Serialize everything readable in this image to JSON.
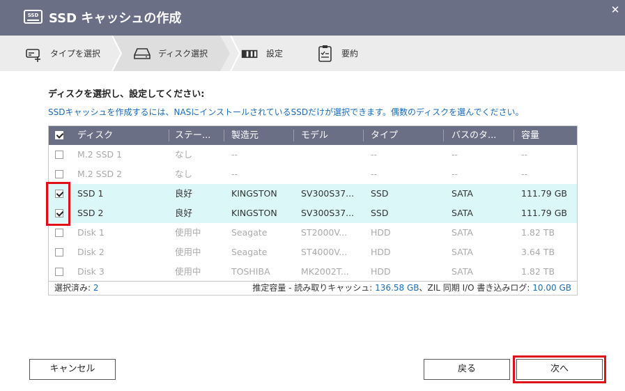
{
  "dialog": {
    "title": "SSD キャッシュの作成",
    "badge": "SSD"
  },
  "steps": [
    {
      "label": "タイプを選択",
      "icon": "type-select-icon"
    },
    {
      "label": "ディスク選択",
      "icon": "disk-icon"
    },
    {
      "label": "設定",
      "icon": "settings-icon"
    },
    {
      "label": "要約",
      "icon": "summary-icon"
    }
  ],
  "heading": "ディスクを選択し、設定してください:",
  "info": "SSDキャッシュを作成するには、NASにインストールされているSSDだけが選択できます。偶数のディスクを選んでください。",
  "table": {
    "columns": [
      "ディスク",
      "ステー...",
      "製造元",
      "モデル",
      "タイプ",
      "バスのタ...",
      "容量"
    ],
    "rows": [
      {
        "disk": "M.2 SSD 1",
        "status": "なし",
        "vendor": "--",
        "model": "",
        "type": "--",
        "bus": "--",
        "capacity": "--",
        "checked": false
      },
      {
        "disk": "M.2 SSD 2",
        "status": "なし",
        "vendor": "--",
        "model": "",
        "type": "--",
        "bus": "--",
        "capacity": "--",
        "checked": false
      },
      {
        "disk": "SSD 1",
        "status": "良好",
        "vendor": "KINGSTON",
        "model": "SV300S37...",
        "type": "SSD",
        "bus": "SATA",
        "capacity": "111.79 GB",
        "checked": true
      },
      {
        "disk": "SSD 2",
        "status": "良好",
        "vendor": "KINGSTON",
        "model": "SV300S37...",
        "type": "SSD",
        "bus": "SATA",
        "capacity": "111.79 GB",
        "checked": true
      },
      {
        "disk": "Disk 1",
        "status": "使用中",
        "vendor": "Seagate",
        "model": "ST2000V...",
        "type": "HDD",
        "bus": "SATA",
        "capacity": "1.82 TB",
        "checked": false
      },
      {
        "disk": "Disk 2",
        "status": "使用中",
        "vendor": "Seagate",
        "model": "ST4000V...",
        "type": "HDD",
        "bus": "SATA",
        "capacity": "3.64 TB",
        "checked": false
      },
      {
        "disk": "Disk 3",
        "status": "使用中",
        "vendor": "TOSHIBA",
        "model": "MK2002T...",
        "type": "HDD",
        "bus": "SATA",
        "capacity": "1.82 TB",
        "checked": false
      }
    ],
    "footer": {
      "selected_label": "選択済み: ",
      "selected_count": "2",
      "estimate_label": "推定容量 - 読み取りキャッシュ: ",
      "read_cache": "136.58 GB",
      "zil_label": "、ZIL 同期 I/O 書き込みログ: ",
      "zil_log": "10.00 GB"
    }
  },
  "buttons": {
    "cancel": "キャンセル",
    "back": "戻る",
    "next": "次へ"
  },
  "colors": {
    "titlebar": "#6a6f86",
    "highlight_row": "#dbf7f7",
    "info_text": "#1a6bb8",
    "annotation": "#e0101a"
  }
}
